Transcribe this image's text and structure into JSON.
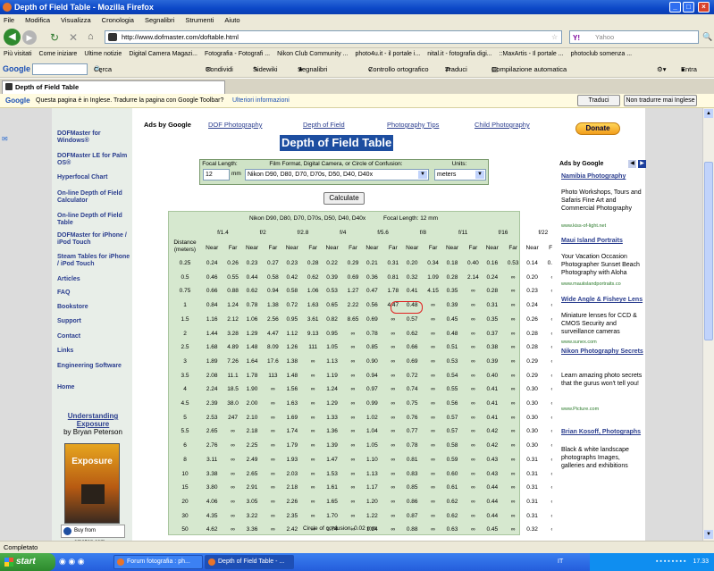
{
  "window": {
    "title": "Depth of Field Table - Mozilla Firefox"
  },
  "menu": [
    "File",
    "Modifica",
    "Visualizza",
    "Cronologia",
    "Segnalibri",
    "Strumenti",
    "Aiuto"
  ],
  "nav": {
    "url": "http://www.dofmaster.com/doftable.html",
    "search_placeholder": "Yahoo"
  },
  "bookmarks": [
    "Più visitati",
    "Come iniziare",
    "Ultime notizie",
    "Digital Camera Magazi...",
    "Fotografia - Fotografi ...",
    "Nikon Club Community ...",
    "photo4u.it - il portale i...",
    "nital.it - fotografia digi...",
    "::MaxArtis - Il portale ...",
    "photoclub somenza ..."
  ],
  "gbar": {
    "google": "Google",
    "cerca": "Cerca",
    "condividi": "Condividi",
    "sidewiki": "Sidewiki",
    "segnalibri": "Segnalibri",
    "ortho": "Controllo ortografico",
    "traduci": "Traduci",
    "compilazione": "Compilazione automatica",
    "entra": "Entra"
  },
  "tab": {
    "label": "Depth of Field Table"
  },
  "translate": {
    "message": "Questa pagina è in Inglese. Tradurre la pagina con Google Toolbar?",
    "more": "Ulteriori informazioni",
    "translate_btn": "Traduci",
    "no_btn": "Non tradurre mai Inglese"
  },
  "left_nav": [
    {
      "label": "DOFMaster for Windows®"
    },
    {
      "label": "DOFMaster LE for Palm OS®"
    },
    {
      "label": "Hyperfocal Chart"
    },
    {
      "label": "On-line Depth of Field Calculator"
    },
    {
      "label": "On-line Depth of Field Table"
    },
    {
      "label": "DOFMaster for iPhone / iPod Touch"
    },
    {
      "label": "Steam Tables for iPhone / iPod Touch"
    },
    {
      "label": "Articles"
    },
    {
      "label": "FAQ"
    },
    {
      "label": "Bookstore"
    },
    {
      "label": "Support"
    },
    {
      "label": "Contact"
    },
    {
      "label": "Links"
    },
    {
      "label": "Engineering Software"
    },
    {
      "label": "Home"
    }
  ],
  "book": {
    "title": "Understanding Exposure",
    "author": "by Bryan Peterson",
    "cover": "Exposure",
    "buy": "Buy from amazon.com"
  },
  "top_links": {
    "ads": "Ads by Google",
    "l1": "DOF Photography",
    "l2": "Depth of Field",
    "l3": "Photography Tips",
    "l4": "Child Photography"
  },
  "donate": "Donate",
  "page_title": "Depth of Field Table",
  "controls": {
    "focal_label": "Focal Length:",
    "focal_value": "12",
    "focal_unit": "mm",
    "film_label": "Film Format, Digital Camera, or Circle of Confusion:",
    "film_value": "Nikon D90, D80, D70, D70s, D50, D40, D40x",
    "units_label": "Units:",
    "units_value": "meters",
    "calc": "Calculate"
  },
  "table": {
    "camera": "Nikon D90, D80, D70, D70s, D50, D40, D40x",
    "focal": "Focal Length: 12 mm",
    "dist_header": "Distance (meters)",
    "apertures": [
      "f/1.4",
      "f/2",
      "f/2.8",
      "f/4",
      "f/5.6",
      "f/8",
      "f/11",
      "f/16",
      "f/22",
      "f/32"
    ],
    "near": "Near",
    "far": "Far",
    "rows": [
      [
        "0.25",
        "0.24",
        "0.26",
        "0.23",
        "0.27",
        "0.23",
        "0.28",
        "0.22",
        "0.29",
        "0.21",
        "0.31",
        "0.20",
        "0.34",
        "0.18",
        "0.40",
        "0.16",
        "0.53",
        "0.14",
        "0.99",
        "0.12",
        "∞"
      ],
      [
        "0.5",
        "0.46",
        "0.55",
        "0.44",
        "0.58",
        "0.42",
        "0.62",
        "0.39",
        "0.69",
        "0.36",
        "0.81",
        "0.32",
        "1.09",
        "0.28",
        "2.14",
        "0.24",
        "∞",
        "0.20",
        "∞",
        "0.16",
        "∞"
      ],
      [
        "0.75",
        "0.66",
        "0.88",
        "0.62",
        "0.94",
        "0.58",
        "1.06",
        "0.53",
        "1.27",
        "0.47",
        "1.78",
        "0.41",
        "4.15",
        "0.35",
        "∞",
        "0.28",
        "∞",
        "0.23",
        "∞",
        "0.18",
        "∞"
      ],
      [
        "1",
        "0.84",
        "1.24",
        "0.78",
        "1.38",
        "0.72",
        "1.63",
        "0.65",
        "2.22",
        "0.56",
        "4.47",
        "0.48",
        "∞",
        "0.39",
        "∞",
        "0.31",
        "∞",
        "0.24",
        "∞",
        "0.19",
        "∞"
      ],
      [
        "1.5",
        "1.16",
        "2.12",
        "1.06",
        "2.56",
        "0.95",
        "3.61",
        "0.82",
        "8.65",
        "0.69",
        "∞",
        "0.57",
        "∞",
        "0.45",
        "∞",
        "0.35",
        "∞",
        "0.26",
        "∞",
        "0.20",
        "∞"
      ],
      [
        "2",
        "1.44",
        "3.28",
        "1.29",
        "4.47",
        "1.12",
        "9.13",
        "0.95",
        "∞",
        "0.78",
        "∞",
        "0.62",
        "∞",
        "0.48",
        "∞",
        "0.37",
        "∞",
        "0.28",
        "∞",
        "0.20",
        "∞"
      ],
      [
        "2.5",
        "1.68",
        "4.89",
        "1.48",
        "8.09",
        "1.26",
        "111",
        "1.05",
        "∞",
        "0.85",
        "∞",
        "0.66",
        "∞",
        "0.51",
        "∞",
        "0.38",
        "∞",
        "0.28",
        "∞",
        "0.21",
        "∞"
      ],
      [
        "3",
        "1.89",
        "7.26",
        "1.64",
        "17.6",
        "1.38",
        "∞",
        "1.13",
        "∞",
        "0.90",
        "∞",
        "0.69",
        "∞",
        "0.53",
        "∞",
        "0.39",
        "∞",
        "0.29",
        "∞",
        "0.21",
        "∞"
      ],
      [
        "3.5",
        "2.08",
        "11.1",
        "1.78",
        "113",
        "1.48",
        "∞",
        "1.19",
        "∞",
        "0.94",
        "∞",
        "0.72",
        "∞",
        "0.54",
        "∞",
        "0.40",
        "∞",
        "0.29",
        "∞",
        "0.21",
        "∞"
      ],
      [
        "4",
        "2.24",
        "18.5",
        "1.90",
        "∞",
        "1.56",
        "∞",
        "1.24",
        "∞",
        "0.97",
        "∞",
        "0.74",
        "∞",
        "0.55",
        "∞",
        "0.41",
        "∞",
        "0.30",
        "∞",
        "0.21",
        "∞"
      ],
      [
        "4.5",
        "2.39",
        "38.0",
        "2.00",
        "∞",
        "1.63",
        "∞",
        "1.29",
        "∞",
        "0.99",
        "∞",
        "0.75",
        "∞",
        "0.56",
        "∞",
        "0.41",
        "∞",
        "0.30",
        "∞",
        "0.21",
        "∞"
      ],
      [
        "5",
        "2.53",
        "247",
        "2.10",
        "∞",
        "1.69",
        "∞",
        "1.33",
        "∞",
        "1.02",
        "∞",
        "0.76",
        "∞",
        "0.57",
        "∞",
        "0.41",
        "∞",
        "0.30",
        "∞",
        "0.21",
        "∞"
      ],
      [
        "5.5",
        "2.65",
        "∞",
        "2.18",
        "∞",
        "1.74",
        "∞",
        "1.36",
        "∞",
        "1.04",
        "∞",
        "0.77",
        "∞",
        "0.57",
        "∞",
        "0.42",
        "∞",
        "0.30",
        "∞",
        "0.22",
        "∞"
      ],
      [
        "6",
        "2.76",
        "∞",
        "2.25",
        "∞",
        "1.79",
        "∞",
        "1.39",
        "∞",
        "1.05",
        "∞",
        "0.78",
        "∞",
        "0.58",
        "∞",
        "0.42",
        "∞",
        "0.30",
        "∞",
        "0.22",
        "∞"
      ],
      [
        "8",
        "3.11",
        "∞",
        "2.49",
        "∞",
        "1.93",
        "∞",
        "1.47",
        "∞",
        "1.10",
        "∞",
        "0.81",
        "∞",
        "0.59",
        "∞",
        "0.43",
        "∞",
        "0.31",
        "∞",
        "0.22",
        "∞"
      ],
      [
        "10",
        "3.38",
        "∞",
        "2.65",
        "∞",
        "2.03",
        "∞",
        "1.53",
        "∞",
        "1.13",
        "∞",
        "0.83",
        "∞",
        "0.60",
        "∞",
        "0.43",
        "∞",
        "0.31",
        "∞",
        "0.22",
        "∞"
      ],
      [
        "15",
        "3.80",
        "∞",
        "2.91",
        "∞",
        "2.18",
        "∞",
        "1.61",
        "∞",
        "1.17",
        "∞",
        "0.85",
        "∞",
        "0.61",
        "∞",
        "0.44",
        "∞",
        "0.31",
        "∞",
        "0.22",
        "∞"
      ],
      [
        "20",
        "4.06",
        "∞",
        "3.05",
        "∞",
        "2.26",
        "∞",
        "1.65",
        "∞",
        "1.20",
        "∞",
        "0.86",
        "∞",
        "0.62",
        "∞",
        "0.44",
        "∞",
        "0.31",
        "∞",
        "0.22",
        "∞"
      ],
      [
        "30",
        "4.35",
        "∞",
        "3.22",
        "∞",
        "2.35",
        "∞",
        "1.70",
        "∞",
        "1.22",
        "∞",
        "0.87",
        "∞",
        "0.62",
        "∞",
        "0.44",
        "∞",
        "0.31",
        "∞",
        "0.22",
        "∞"
      ],
      [
        "50",
        "4.62",
        "∞",
        "3.36",
        "∞",
        "2.42",
        "∞",
        "1.74",
        "∞",
        "1.24",
        "∞",
        "0.88",
        "∞",
        "0.63",
        "∞",
        "0.45",
        "∞",
        "0.32",
        "∞",
        "0.22",
        "∞"
      ],
      [
        "∞",
        "5.10",
        "∞",
        "3.61",
        "∞",
        "2.56",
        "∞",
        "1.81",
        "∞",
        "1.28",
        "∞",
        "0.91",
        "∞",
        "0.65",
        "∞",
        "0.46",
        "∞",
        "0.33",
        "∞",
        "0.24",
        "∞"
      ]
    ],
    "hyper_label": "Hyperfocal Distance",
    "hyper": [
      "5.10",
      "3.61",
      "2.56",
      "1.81",
      "1.28",
      "0.91",
      "0.65",
      "0.46",
      "0.33",
      "0.24"
    ],
    "coc": "Circle of confusion: 0.02 mm"
  },
  "right_ads": {
    "header": "Ads by Google",
    "ads": [
      {
        "title": "Namibia Photography",
        "body": "Photo Workshops, Tours and Safaris Fine Art and Commercial Photography",
        "url": "www.kiss-of-light.net"
      },
      {
        "title": "Maui Island Portraits",
        "body": "Your Vacation Occasion Photographer Sunset Beach Photography with Aloha",
        "url": "www.mauiislandportraits.co"
      },
      {
        "title": "Wide Angle & Fisheye Lens",
        "body": "Miniature lenses for CCD & CMOS Security and surveillance cameras",
        "url": "www.sunex.com"
      },
      {
        "title": "Nikon Photography Secrets",
        "body": "Learn amazing photo secrets that the gurus won't tell you!",
        "url": "www.Picture.com"
      },
      {
        "title": "Brian Kosoff, Photographs",
        "body": "Black & white landscape photographs Images, galleries and exhibitions",
        "url": ""
      }
    ]
  },
  "status": "Completato",
  "taskbar": {
    "start": "start",
    "task1": "Forum fotografia : ph...",
    "task2": "Depth of Field Table - ...",
    "lang": "IT",
    "clock": "17.33"
  }
}
